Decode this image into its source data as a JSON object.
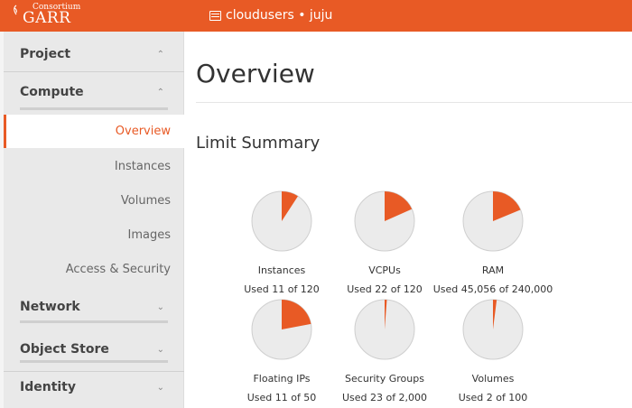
{
  "header": {
    "brand_small": "Consortium",
    "brand_large": "GARR",
    "project_context": "cloudusers • juju"
  },
  "sidebar": {
    "project": "Project",
    "compute": "Compute",
    "compute_items": [
      "Overview",
      "Instances",
      "Volumes",
      "Images",
      "Access & Security"
    ],
    "network": "Network",
    "object_store": "Object Store",
    "identity": "Identity"
  },
  "main": {
    "title": "Overview",
    "limit_summary_title": "Limit Summary"
  },
  "colors": {
    "accent": "#e85a25",
    "pie_bg": "#ebebeb"
  },
  "limits": [
    {
      "label": "Instances",
      "used_text": "Used 11 of 120",
      "used": 11,
      "total": 120
    },
    {
      "label": "VCPUs",
      "used_text": "Used 22 of 120",
      "used": 22,
      "total": 120
    },
    {
      "label": "RAM",
      "used_text": "Used 45,056 of 240,000",
      "used": 45056,
      "total": 240000
    },
    {
      "label": "Floating IPs",
      "used_text": "Used 11 of 50",
      "used": 11,
      "total": 50
    },
    {
      "label": "Security Groups",
      "used_text": "Used 23 of 2,000",
      "used": 23,
      "total": 2000
    },
    {
      "label": "Volumes",
      "used_text": "Used 2 of 100",
      "used": 2,
      "total": 100
    }
  ]
}
